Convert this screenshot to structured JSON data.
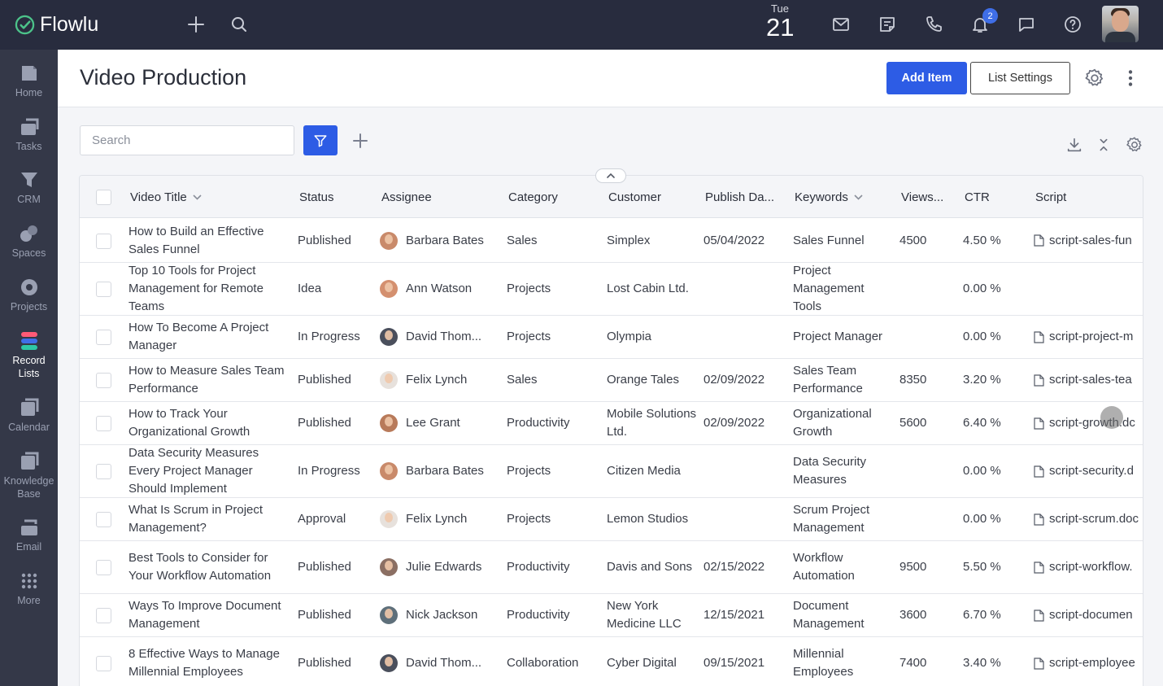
{
  "app": {
    "name": "Flowlu",
    "date_dow": "Tue",
    "date_day": "21",
    "notifications_count": "2"
  },
  "icons": {
    "add": "plus-icon",
    "search": "search-icon",
    "mail": "mail-icon",
    "notes": "notes-icon",
    "phone": "phone-icon",
    "bell": "bell-icon",
    "chat": "chat-icon",
    "help": "help-icon"
  },
  "sidebar": {
    "items": [
      {
        "label": "Home",
        "icon": "home-icon"
      },
      {
        "label": "Tasks",
        "icon": "tasks-icon"
      },
      {
        "label": "CRM",
        "icon": "crm-icon"
      },
      {
        "label": "Spaces",
        "icon": "spaces-icon"
      },
      {
        "label": "Projects",
        "icon": "projects-icon"
      },
      {
        "label": "Record Lists",
        "icon": "record-lists-icon"
      },
      {
        "label": "Calendar",
        "icon": "calendar-icon"
      },
      {
        "label": "Knowledge Base",
        "icon": "knowledge-base-icon"
      },
      {
        "label": "Email",
        "icon": "email-icon"
      },
      {
        "label": "More",
        "icon": "grid-dots-icon"
      }
    ],
    "active_index": 5,
    "accent_color": "#3f6ee7"
  },
  "header": {
    "title": "Video Production",
    "add_item_label": "Add Item",
    "list_settings_label": "List Settings"
  },
  "toolbar": {
    "search_placeholder": "Search"
  },
  "table": {
    "columns": [
      "Video Title",
      "Status",
      "Assignee",
      "Category",
      "Customer",
      "Publish Da...",
      "Keywords",
      "Views...",
      "CTR",
      "Script"
    ],
    "rows": [
      {
        "title": "How to Build an Effective Sales Funnel",
        "status": "Published",
        "assignee": "Barbara Bates",
        "category": "Sales",
        "customer": "Simplex",
        "publish": "05/04/2022",
        "keywords": "Sales Funnel",
        "views": "4500",
        "ctr": "4.50 %",
        "script": "script-sales-fun"
      },
      {
        "title": "Top 10 Tools for Project Management for Remote Teams",
        "status": "Idea",
        "assignee": "Ann Watson",
        "category": "Projects",
        "customer": "Lost Cabin Ltd.",
        "publish": "",
        "keywords": "Project Management Tools",
        "views": "",
        "ctr": "0.00 %",
        "script": ""
      },
      {
        "title": "How To Become A Project Manager",
        "status": "In Progress",
        "assignee": "David Thom...",
        "category": "Projects",
        "customer": "Olympia",
        "publish": "",
        "keywords": "Project Manager",
        "views": "",
        "ctr": "0.00 %",
        "script": "script-project-m"
      },
      {
        "title": "How to Measure Sales Team Performance",
        "status": "Published",
        "assignee": "Felix Lynch",
        "category": "Sales",
        "customer": "Orange Tales",
        "publish": "02/09/2022",
        "keywords": "Sales Team Performance",
        "views": "8350",
        "ctr": "3.20 %",
        "script": "script-sales-tea"
      },
      {
        "title": "How to Track Your Organizational Growth",
        "status": "Published",
        "assignee": "Lee Grant",
        "category": "Productivity",
        "customer": "Mobile Solutions Ltd.",
        "publish": "02/09/2022",
        "keywords": "Organizational Growth",
        "views": "5600",
        "ctr": "6.40 %",
        "script": "script-growth.dc"
      },
      {
        "title": "Data Security Measures Every Project Manager Should Implement",
        "status": "In Progress",
        "assignee": "Barbara Bates",
        "category": "Projects",
        "customer": "Citizen Media",
        "publish": "",
        "keywords": "Data Security Measures",
        "views": "",
        "ctr": "0.00 %",
        "script": "script-security.d"
      },
      {
        "title": "What Is Scrum in Project Management?",
        "status": "Approval",
        "assignee": "Felix Lynch",
        "category": "Projects",
        "customer": "Lemon Studios",
        "publish": "",
        "keywords": "Scrum Project Management",
        "views": "",
        "ctr": "0.00 %",
        "script": "script-scrum.doc"
      },
      {
        "title": "Best Tools to Consider for Your Workflow Automation",
        "status": "Published",
        "assignee": "Julie Edwards",
        "category": "Productivity",
        "customer": "Davis and Sons",
        "publish": "02/15/2022",
        "keywords": "Workflow Automation",
        "views": "9500",
        "ctr": "5.50 %",
        "script": "script-workflow."
      },
      {
        "title": "Ways To Improve Document Management",
        "status": "Published",
        "assignee": "Nick Jackson",
        "category": "Productivity",
        "customer": "New York Medicine LLC",
        "publish": "12/15/2021",
        "keywords": "Document Management",
        "views": "3600",
        "ctr": "6.70 %",
        "script": "script-documen"
      },
      {
        "title": "8 Effective Ways to Manage Millennial Employees",
        "status": "Published",
        "assignee": "David Thom...",
        "category": "Collaboration",
        "customer": "Cyber Digital",
        "publish": "09/15/2021",
        "keywords": "Millennial Employees",
        "views": "7400",
        "ctr": "3.40 %",
        "script": "script-employee"
      }
    ]
  }
}
